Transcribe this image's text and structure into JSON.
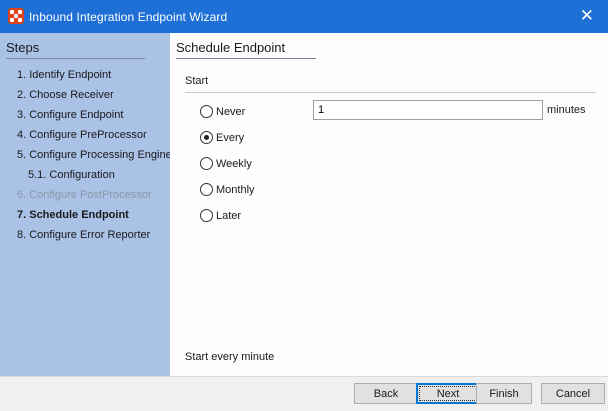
{
  "window": {
    "title": "Inbound Integration Endpoint Wizard",
    "close_glyph": "✕"
  },
  "sidebar": {
    "header": "Steps",
    "steps": [
      {
        "label": "1. Identify Endpoint",
        "state": "normal"
      },
      {
        "label": "2. Choose Receiver",
        "state": "normal"
      },
      {
        "label": "3. Configure Endpoint",
        "state": "normal"
      },
      {
        "label": "4. Configure PreProcessor",
        "state": "normal"
      },
      {
        "label": "5. Configure Processing Engine",
        "state": "normal"
      },
      {
        "label": "5.1. Configuration",
        "state": "normal"
      },
      {
        "label": "6. Configure PostProcessor",
        "state": "disabled"
      },
      {
        "label": "7. Schedule Endpoint",
        "state": "current"
      },
      {
        "label": "8. Configure Error Reporter",
        "state": "normal"
      }
    ]
  },
  "main": {
    "title": "Schedule Endpoint",
    "section_label": "Start",
    "options": [
      {
        "label": "Never",
        "checked": false
      },
      {
        "label": "Every",
        "checked": true
      },
      {
        "label": "Weekly",
        "checked": false
      },
      {
        "label": "Monthly",
        "checked": false
      },
      {
        "label": "Later",
        "checked": false
      }
    ],
    "interval_value": "1",
    "interval_units": "minutes",
    "summary": "Start every minute"
  },
  "footer": {
    "back": "Back",
    "next": "Next",
    "finish": "Finish",
    "cancel": "Cancel"
  }
}
